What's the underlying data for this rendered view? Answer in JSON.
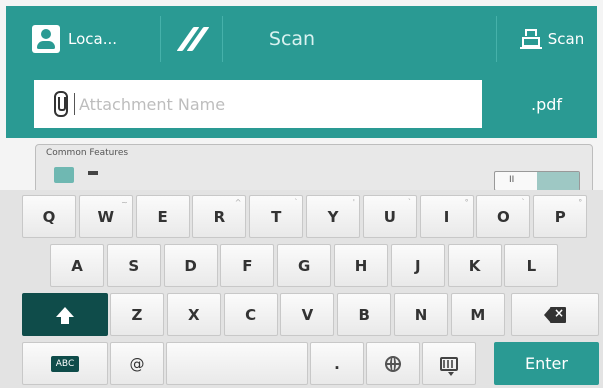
{
  "header": {
    "user_label": "Loca...",
    "title": "Scan",
    "scan_label": "Scan"
  },
  "attachment": {
    "placeholder": "Attachment Name",
    "value": "",
    "extension": ".pdf"
  },
  "features": {
    "label": "Common Features",
    "toggle_mark": "II"
  },
  "keyboard": {
    "row1": [
      {
        "k": "Q",
        "s": ""
      },
      {
        "k": "W",
        "s": "~"
      },
      {
        "k": "E",
        "s": ""
      },
      {
        "k": "R",
        "s": "^"
      },
      {
        "k": "T",
        "s": "`"
      },
      {
        "k": "Y",
        "s": "'"
      },
      {
        "k": "U",
        "s": "`"
      },
      {
        "k": "I",
        "s": "°"
      },
      {
        "k": "O",
        "s": "`"
      },
      {
        "k": "P",
        "s": "°"
      }
    ],
    "row2": [
      "A",
      "S",
      "D",
      "F",
      "G",
      "H",
      "J",
      "K",
      "L"
    ],
    "row3": [
      "Z",
      "X",
      "C",
      "V",
      "B",
      "N",
      "M"
    ],
    "lang_label": "ABC",
    "at_label": "@",
    "period_label": ".",
    "enter_label": "Enter"
  },
  "colors": {
    "accent": "#2a9a93",
    "dark_key": "#0f4c4a",
    "keyboard_bg": "#e3e3e3"
  }
}
